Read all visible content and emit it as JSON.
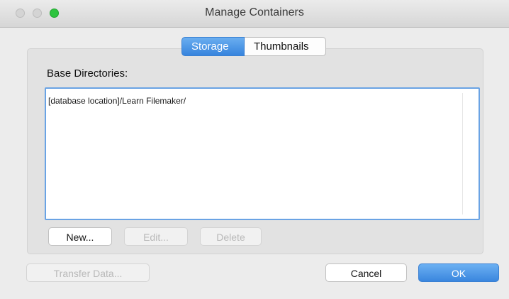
{
  "window": {
    "title": "Manage Containers"
  },
  "tabs": [
    {
      "label": "Storage",
      "selected": true
    },
    {
      "label": "Thumbnails",
      "selected": false
    }
  ],
  "storage": {
    "base_directories_label": "Base Directories:",
    "directories": [
      "[database location]/Learn Filemaker/"
    ]
  },
  "list_buttons": {
    "new_label": "New...",
    "edit_label": "Edit...",
    "delete_label": "Delete"
  },
  "footer": {
    "transfer_label": "Transfer Data...",
    "cancel_label": "Cancel",
    "ok_label": "OK"
  },
  "colors": {
    "accent": "#3a86de",
    "zoom_button": "#2ec43f",
    "list_focus_border": "#6aa3e4"
  }
}
